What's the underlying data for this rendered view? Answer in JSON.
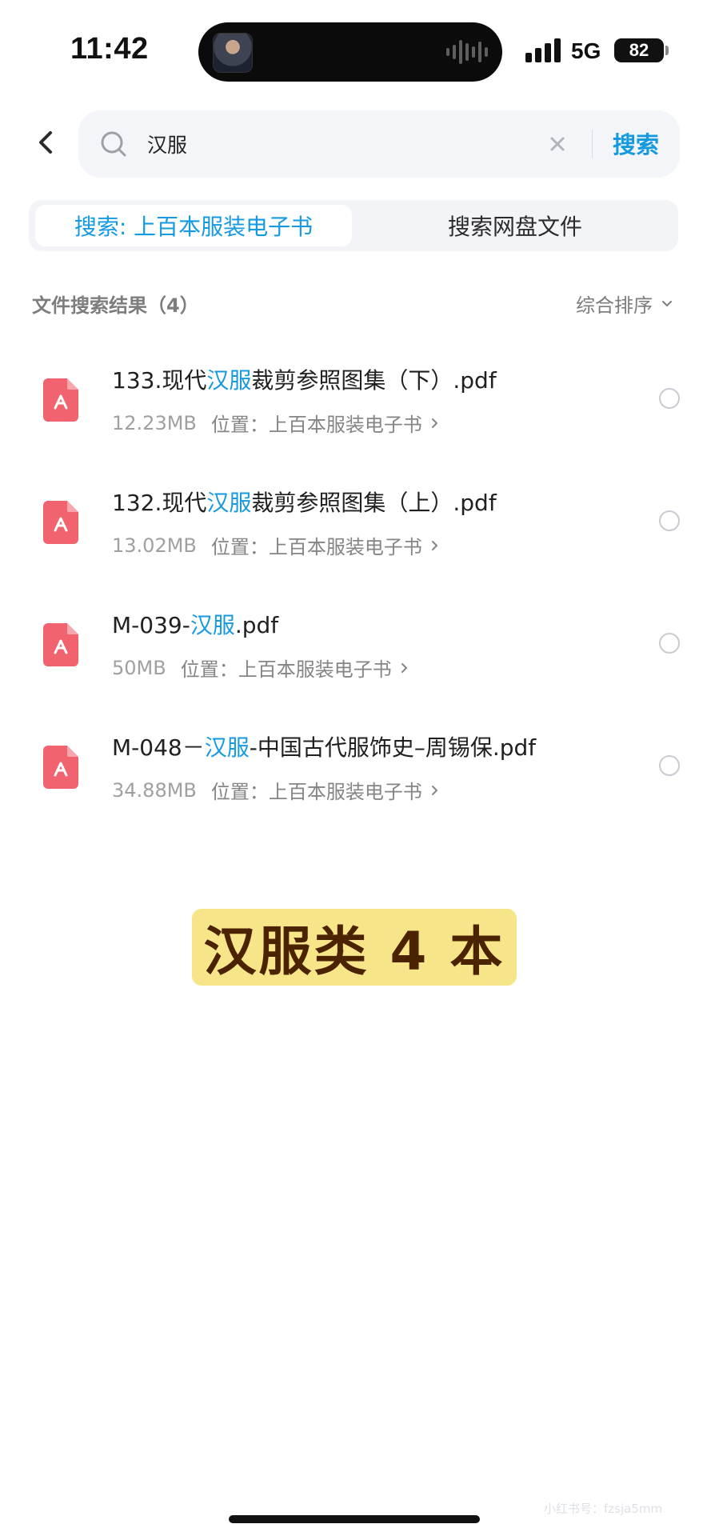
{
  "status_bar": {
    "time": "11:42",
    "network": "5G",
    "battery": "82",
    "icons": {
      "signal": "signal-icon",
      "battery": "battery-icon",
      "audio_wave": "audio-wave-icon"
    }
  },
  "search": {
    "query": "汉服",
    "button_label": "搜索",
    "icons": {
      "back": "back-icon",
      "search": "search-icon",
      "clear": "clear-icon"
    }
  },
  "scope_tabs": {
    "active": "搜索: 上百本服装电子书",
    "inactive": "搜索网盘文件"
  },
  "results": {
    "title": "文件搜索结果（4）",
    "sort_label": "综合排序"
  },
  "files": [
    {
      "name_prefix": "133.现代",
      "name_highlight": "汉服",
      "name_suffix": "裁剪参照图集（下）.pdf",
      "size": "12.23MB",
      "location_label": "位置：",
      "location_value": "上百本服装电子书",
      "icon": "pdf-file-icon"
    },
    {
      "name_prefix": "132.现代",
      "name_highlight": "汉服",
      "name_suffix": "裁剪参照图集（上）.pdf",
      "size": "13.02MB",
      "location_label": "位置：",
      "location_value": "上百本服装电子书",
      "icon": "pdf-file-icon"
    },
    {
      "name_prefix": "M-039-",
      "name_highlight": "汉服",
      "name_suffix": ".pdf",
      "size": "50MB",
      "location_label": "位置：",
      "location_value": "上百本服装电子书",
      "icon": "pdf-file-icon"
    },
    {
      "name_prefix": "M-048－",
      "name_highlight": "汉服",
      "name_suffix": "-中国古代服饰史–周锡保.pdf",
      "size": "34.88MB",
      "location_label": "位置：",
      "location_value": "上百本服装电子书",
      "icon": "pdf-file-icon"
    }
  ],
  "overlay": {
    "caption": "汉服类 4 本"
  },
  "watermark": {
    "text": "小红书号：fzsja5mm"
  },
  "colors": {
    "accent": "#159ae0",
    "pdf_red": "#f1636f",
    "caption_bg": "#f7e58a",
    "caption_text": "#4b2300"
  }
}
